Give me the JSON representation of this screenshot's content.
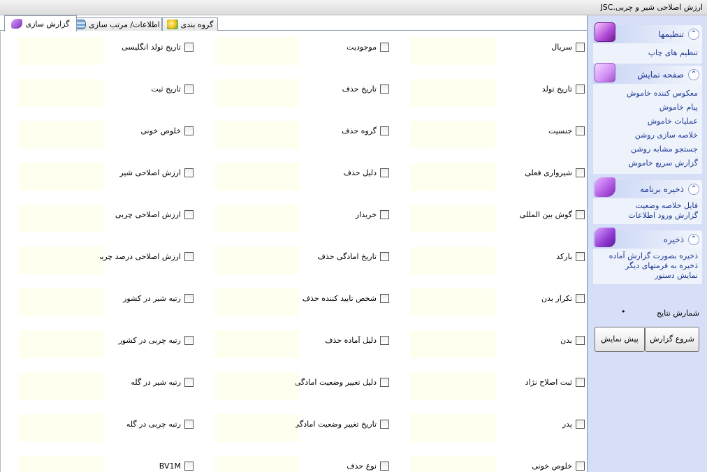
{
  "window": {
    "title": "ارزش اصلاحی شیر و چربی.JSC"
  },
  "tabs": [
    {
      "label": "گزارش سازی",
      "icon": "report-icon"
    },
    {
      "label": "اطلاعات/ مرتب سازی",
      "icon": "database-icon"
    },
    {
      "label": "گروه بندی",
      "icon": "grouping-icon"
    }
  ],
  "fields": {
    "col1": [
      "سریال",
      "تاریخ تولد",
      "جنسیت",
      "شیرواری فعلی",
      "گوش بین المللی",
      "بارکد",
      "تکرار بدن",
      "بدن",
      "ثبت اصلاح نژاد",
      "پدر",
      "خلوص خونی"
    ],
    "col2": [
      "موجودیت",
      "تاریخ حذف",
      "گروه حذف",
      "دلیل حذف",
      "خریدار",
      "تاریخ امادگی حذف",
      "شخص تایید کننده حذف",
      "دلیل آماده حذف",
      "دلیل تغییر وضعیت  امادگی حذف",
      "تاریخ تغییر وضعیت  امادگی حذف",
      "نوع حذف"
    ],
    "col3": [
      "تاریخ تولد انگلیسی",
      "تاریخ ثبت",
      "خلوص خونی",
      "ارزش اصلاحی شیر",
      "ارزش اصلاحی چربی",
      "ارزش اصلاحی درصد چربی",
      "رتبه شیر در کشور",
      "رتبه چربی در کشور",
      "رتبه شیر در گله",
      "رتبه چربی در گله",
      "BV1M"
    ]
  },
  "sidebar": {
    "settings": {
      "title": "تنظیمها",
      "items": [
        "تنظیم های چاپ"
      ]
    },
    "display": {
      "title": "صفحه نمایش",
      "items": [
        "معکوس کننده خاموش",
        "پیام خاموش",
        "عملیات خاموش",
        "خلاصه سازی روشن",
        "جستجو مشابه روشن",
        "گزارش سریع خاموش"
      ]
    },
    "save_program": {
      "title": "ذخیره برنامه",
      "items": [
        "فایل خلاصه وضعیت",
        "گزارش ورود اطلاعات"
      ]
    },
    "save": {
      "title": "ذخیره",
      "items": [
        "ذخیره بصورت گزارش آماده",
        "ذخیره به فرمتهای دیگر",
        "نمایش دستور"
      ]
    },
    "results_count_label": "شمارش نتایج",
    "results_count_value": "•"
  },
  "buttons": {
    "start_report": "شروع گزارش",
    "preview": "پیش نمایش"
  },
  "colors": {
    "sidebar_bg": "#d6dff7",
    "panel_title": "#1f3a93",
    "field_bg": "#fffff0"
  }
}
